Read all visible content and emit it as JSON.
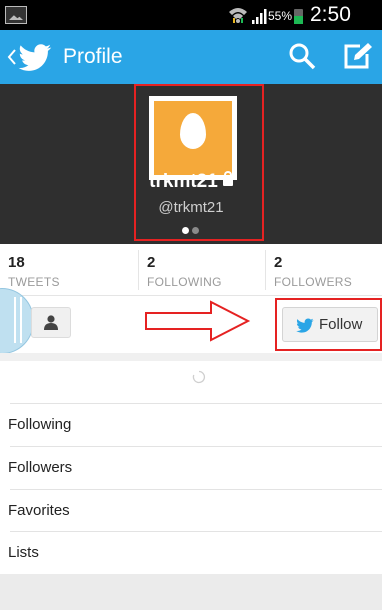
{
  "status_bar": {
    "battery_text": "55%",
    "battery_level": 0.55,
    "time": "2:50 PM",
    "icons": [
      "gallery-icon",
      "wifi-icon",
      "signal-icon",
      "battery-icon"
    ]
  },
  "action_bar": {
    "title": "Profile",
    "icons": [
      "back-chevron-icon",
      "twitter-bird-icon",
      "search-icon",
      "compose-icon"
    ],
    "color": "#2aa5e6"
  },
  "profile": {
    "screen_name": "trkmt21",
    "handle": "@trkmt21",
    "avatar_color": "#f5a93a",
    "protected_icon": "lock-icon",
    "page_indicator": {
      "count": 2,
      "active": 0
    }
  },
  "stats": [
    {
      "number": "18",
      "label": "TWEETS"
    },
    {
      "number": "2",
      "label": "FOLLOWING"
    },
    {
      "number": "2",
      "label": "FOLLOWERS"
    }
  ],
  "actions": {
    "follow_label": "Follow",
    "person_icon": "person-icon"
  },
  "menu": [
    {
      "label": "Following"
    },
    {
      "label": "Followers"
    },
    {
      "label": "Favorites"
    },
    {
      "label": "Lists"
    }
  ],
  "colors": {
    "highlight": "#e52222",
    "header_bg": "#2f2f2f",
    "twitter_blue": "#2aa5e6"
  }
}
